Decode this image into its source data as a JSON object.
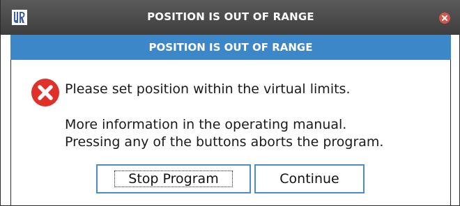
{
  "window": {
    "title": "POSITION IS OUT OF RANGE",
    "logo_icon": "ur-logo-icon",
    "close_icon": "close-icon"
  },
  "header": {
    "text": "POSITION IS OUT OF RANGE"
  },
  "message": {
    "icon": "error-icon",
    "line1": "Please set position within the virtual limits.",
    "line2": "More information in the operating manual.",
    "line3": "Pressing any of the buttons aborts the program."
  },
  "buttons": {
    "stop_label": "Stop Program",
    "continue_label": "Continue"
  },
  "colors": {
    "titlebar": "#4a4a4a",
    "header": "#3c87c8",
    "error_red": "#e0302a",
    "button_border": "#4a8ccb"
  }
}
